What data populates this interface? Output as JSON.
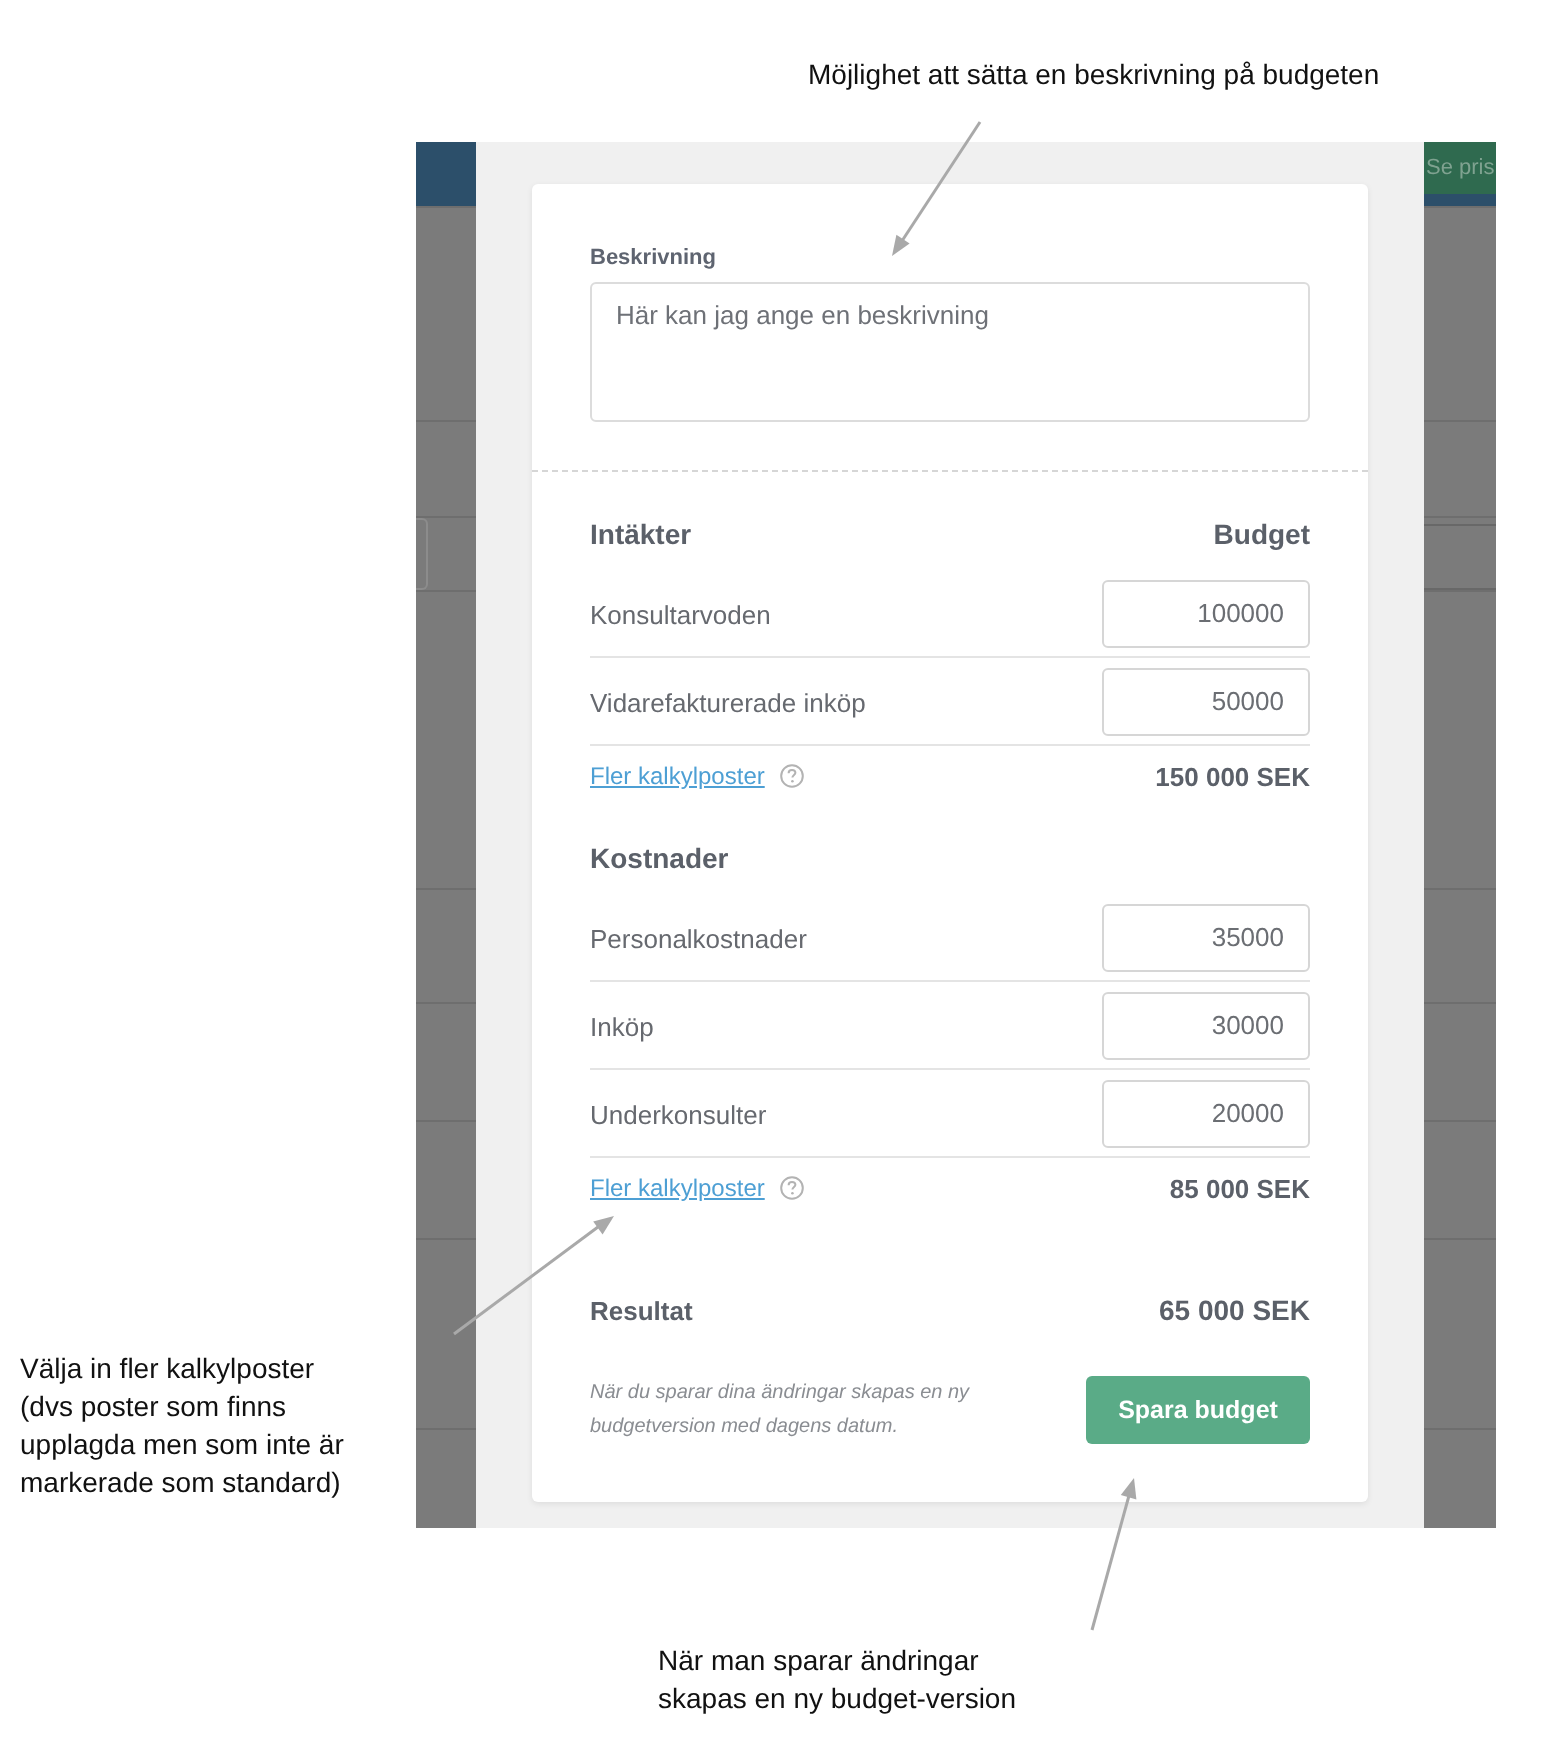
{
  "annotations": {
    "description_note": "Möjlighet att sätta en beskrivning på budgeten",
    "extra_items_note": "Välja in fler kalkylposter\n(dvs poster som finns\nupplagda men som inte är\nmarkerade som standard)",
    "save_note": "När man sparar ändringar\nskapas en ny budget-version"
  },
  "background_app": {
    "header_button": "Se pris"
  },
  "budget_form": {
    "description": {
      "label": "Beskrivning",
      "value": "Här kan jag ange en beskrivning"
    },
    "sections": [
      {
        "title": "Intäkter",
        "column_header": "Budget",
        "rows": [
          {
            "name": "Konsultarvoden",
            "value": "100000"
          },
          {
            "name": "Vidarefakturerade inköp",
            "value": "50000"
          }
        ],
        "more_link": "Fler kalkylposter",
        "total": "150 000 SEK"
      },
      {
        "title": "Kostnader",
        "rows": [
          {
            "name": "Personalkostnader",
            "value": "35000"
          },
          {
            "name": "Inköp",
            "value": "30000"
          },
          {
            "name": "Underkonsulter",
            "value": "20000"
          }
        ],
        "more_link": "Fler kalkylposter",
        "total": "85 000 SEK"
      }
    ],
    "result": {
      "label": "Resultat",
      "value": "65 000 SEK"
    },
    "footer_note": "När du sparar dina ändringar skapas en ny\nbudgetversion med dagens datum.",
    "save_button": "Spara budget"
  }
}
